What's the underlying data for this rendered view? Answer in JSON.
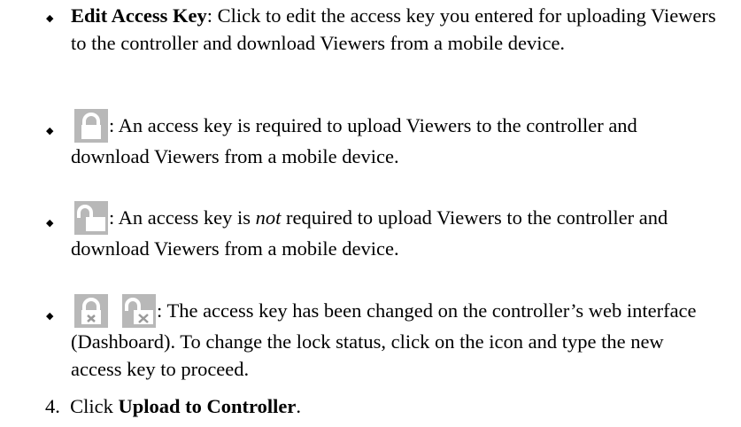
{
  "bullets": [
    {
      "title": "Edit Access Key",
      "text": ": Click to edit the access key you entered for uploading Viewers to the controller and download Viewers from a mobile device."
    },
    {
      "icon": "lock-closed-icon",
      "text": ": An access key is required to upload Viewers to the controller and download Viewers from a mobile device."
    },
    {
      "icon": "lock-open-icon",
      "text_before": ": An access key is ",
      "emphasis": "not",
      "text_after": " required to upload Viewers to the controller and download Viewers from a mobile device."
    },
    {
      "icons": [
        "lock-closed-x-icon",
        "lock-open-x-icon"
      ],
      "text": ": The access key has been changed on the controller’s web interface (Dashboard). To change the lock status, click on the icon and type the new access key to proceed."
    }
  ],
  "step": {
    "number": "4.",
    "prefix": "Click ",
    "action": "Upload to Controller",
    "suffix": "."
  },
  "colors": {
    "icon_bg": "#b8b8b8",
    "icon_glyph": "#ffffff",
    "x_bg": "#ffffff",
    "x_mark": "#9a9a9a"
  }
}
